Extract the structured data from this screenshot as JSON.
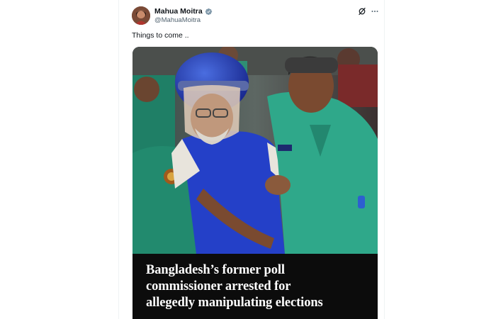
{
  "post": {
    "author": {
      "display_name": "Mahua Moitra",
      "handle": "@MahuaMoitra",
      "verified": true,
      "verified_badge_color": "#829aab"
    },
    "text": "Things to come ..",
    "media": {
      "headline": "Bangladesh’s former poll\ncommissioner arrested for\nallegedly manipulating elections"
    }
  },
  "icons": {
    "verified": "verified-badge-icon",
    "grok": "grok-icon",
    "more": "more-horizontal-icon"
  },
  "colors": {
    "text_primary": "#0f1419",
    "text_secondary": "#536471",
    "headline_band": "#0c0c0c",
    "uniform_green": "#2fa88a"
  }
}
